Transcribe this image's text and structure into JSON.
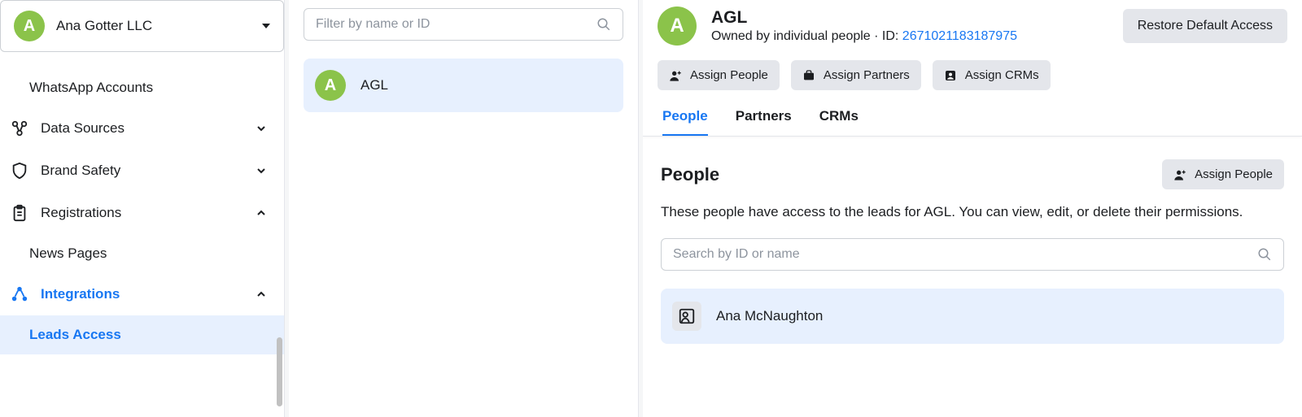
{
  "account": {
    "avatar_initial": "A",
    "name": "Ana Gotter LLC"
  },
  "sidebar": {
    "items": [
      {
        "label": "WhatsApp Accounts"
      },
      {
        "label": "Data Sources"
      },
      {
        "label": "Brand Safety"
      },
      {
        "label": "Registrations"
      },
      {
        "label": "News Pages"
      },
      {
        "label": "Integrations"
      },
      {
        "label": "Leads Access"
      }
    ]
  },
  "filter": {
    "placeholder": "Filter by name or ID"
  },
  "pages": [
    {
      "initial": "A",
      "name": "AGL"
    }
  ],
  "detail": {
    "avatar_initial": "A",
    "title": "AGL",
    "owned_prefix": "Owned by individual people · ID: ",
    "id": "2671021183187975",
    "restore_label": "Restore Default Access",
    "assign_people_label": "Assign People",
    "assign_partners_label": "Assign Partners",
    "assign_crms_label": "Assign CRMs",
    "tabs": {
      "people": "People",
      "partners": "Partners",
      "crms": "CRMs"
    },
    "people_section": {
      "heading": "People",
      "assign_label": "Assign People",
      "description": "These people have access to the leads for AGL. You can view, edit, or delete their permissions.",
      "search_placeholder": "Search by ID or name",
      "users": [
        {
          "name": "Ana McNaughton"
        }
      ]
    }
  }
}
